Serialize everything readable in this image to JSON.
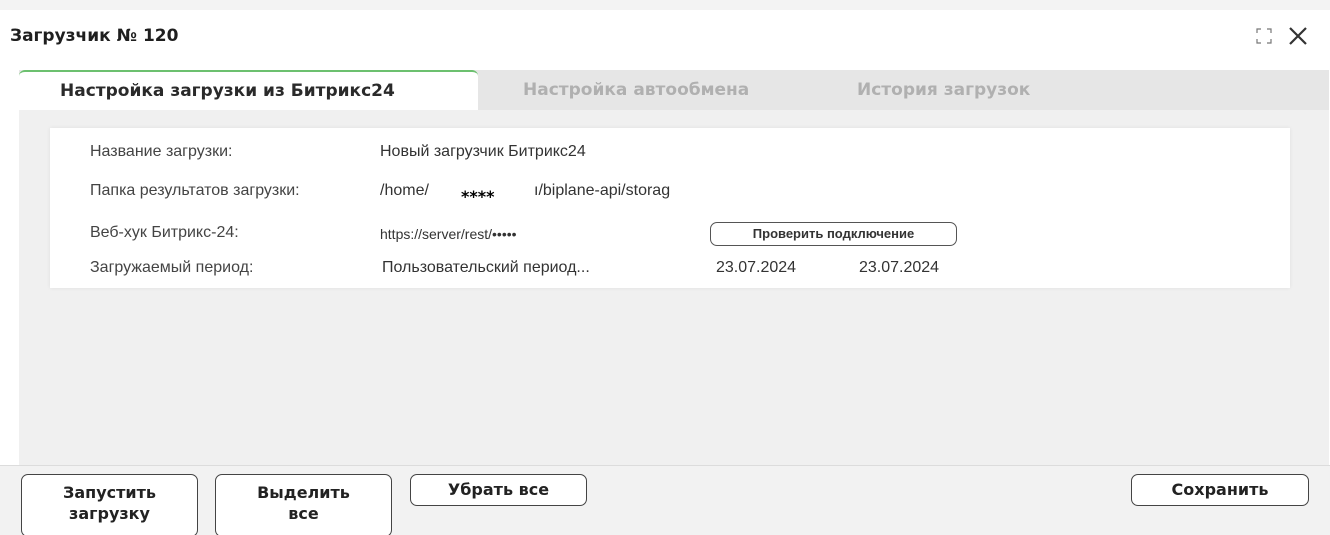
{
  "window": {
    "title": "Загрузчик № 120"
  },
  "tabs": [
    {
      "label": "Настройка загрузки из Битрикс24",
      "active": true
    },
    {
      "label": "Настройка автообмена",
      "active": false
    },
    {
      "label": "История загрузок",
      "active": false
    }
  ],
  "form": {
    "name_label": "Название загрузки:",
    "name_value": "Новый загрузчик Битрикс24",
    "folder_label": "Папка результатов загрузки:",
    "folder_value_start": "/home/",
    "folder_mask": "****",
    "folder_value_end": "ı/biplane-api/storag",
    "webhook_label": "Веб-хук Битрикс-24:",
    "webhook_value": "https://server/rest/•••••",
    "check_button_label": "Проверить подключение",
    "period_label": "Загружаемый период:",
    "period_value": "Пользовательский период...",
    "date_from": "23.07.2024",
    "date_to": "23.07.2024"
  },
  "footer": {
    "start_label_line1": "Запустить",
    "start_label_line2": "загрузку",
    "select_label_line1": "Выделить",
    "select_label_line2": "все",
    "remove_label": "Убрать все",
    "save_label": "Сохранить"
  },
  "colors": {
    "active_tab_accent": "#6cc06f",
    "tab_bar_bg": "#e6e6e6",
    "inactive_tab_text": "#b0b0b0"
  },
  "icons": [
    "expand-icon",
    "close-icon"
  ]
}
